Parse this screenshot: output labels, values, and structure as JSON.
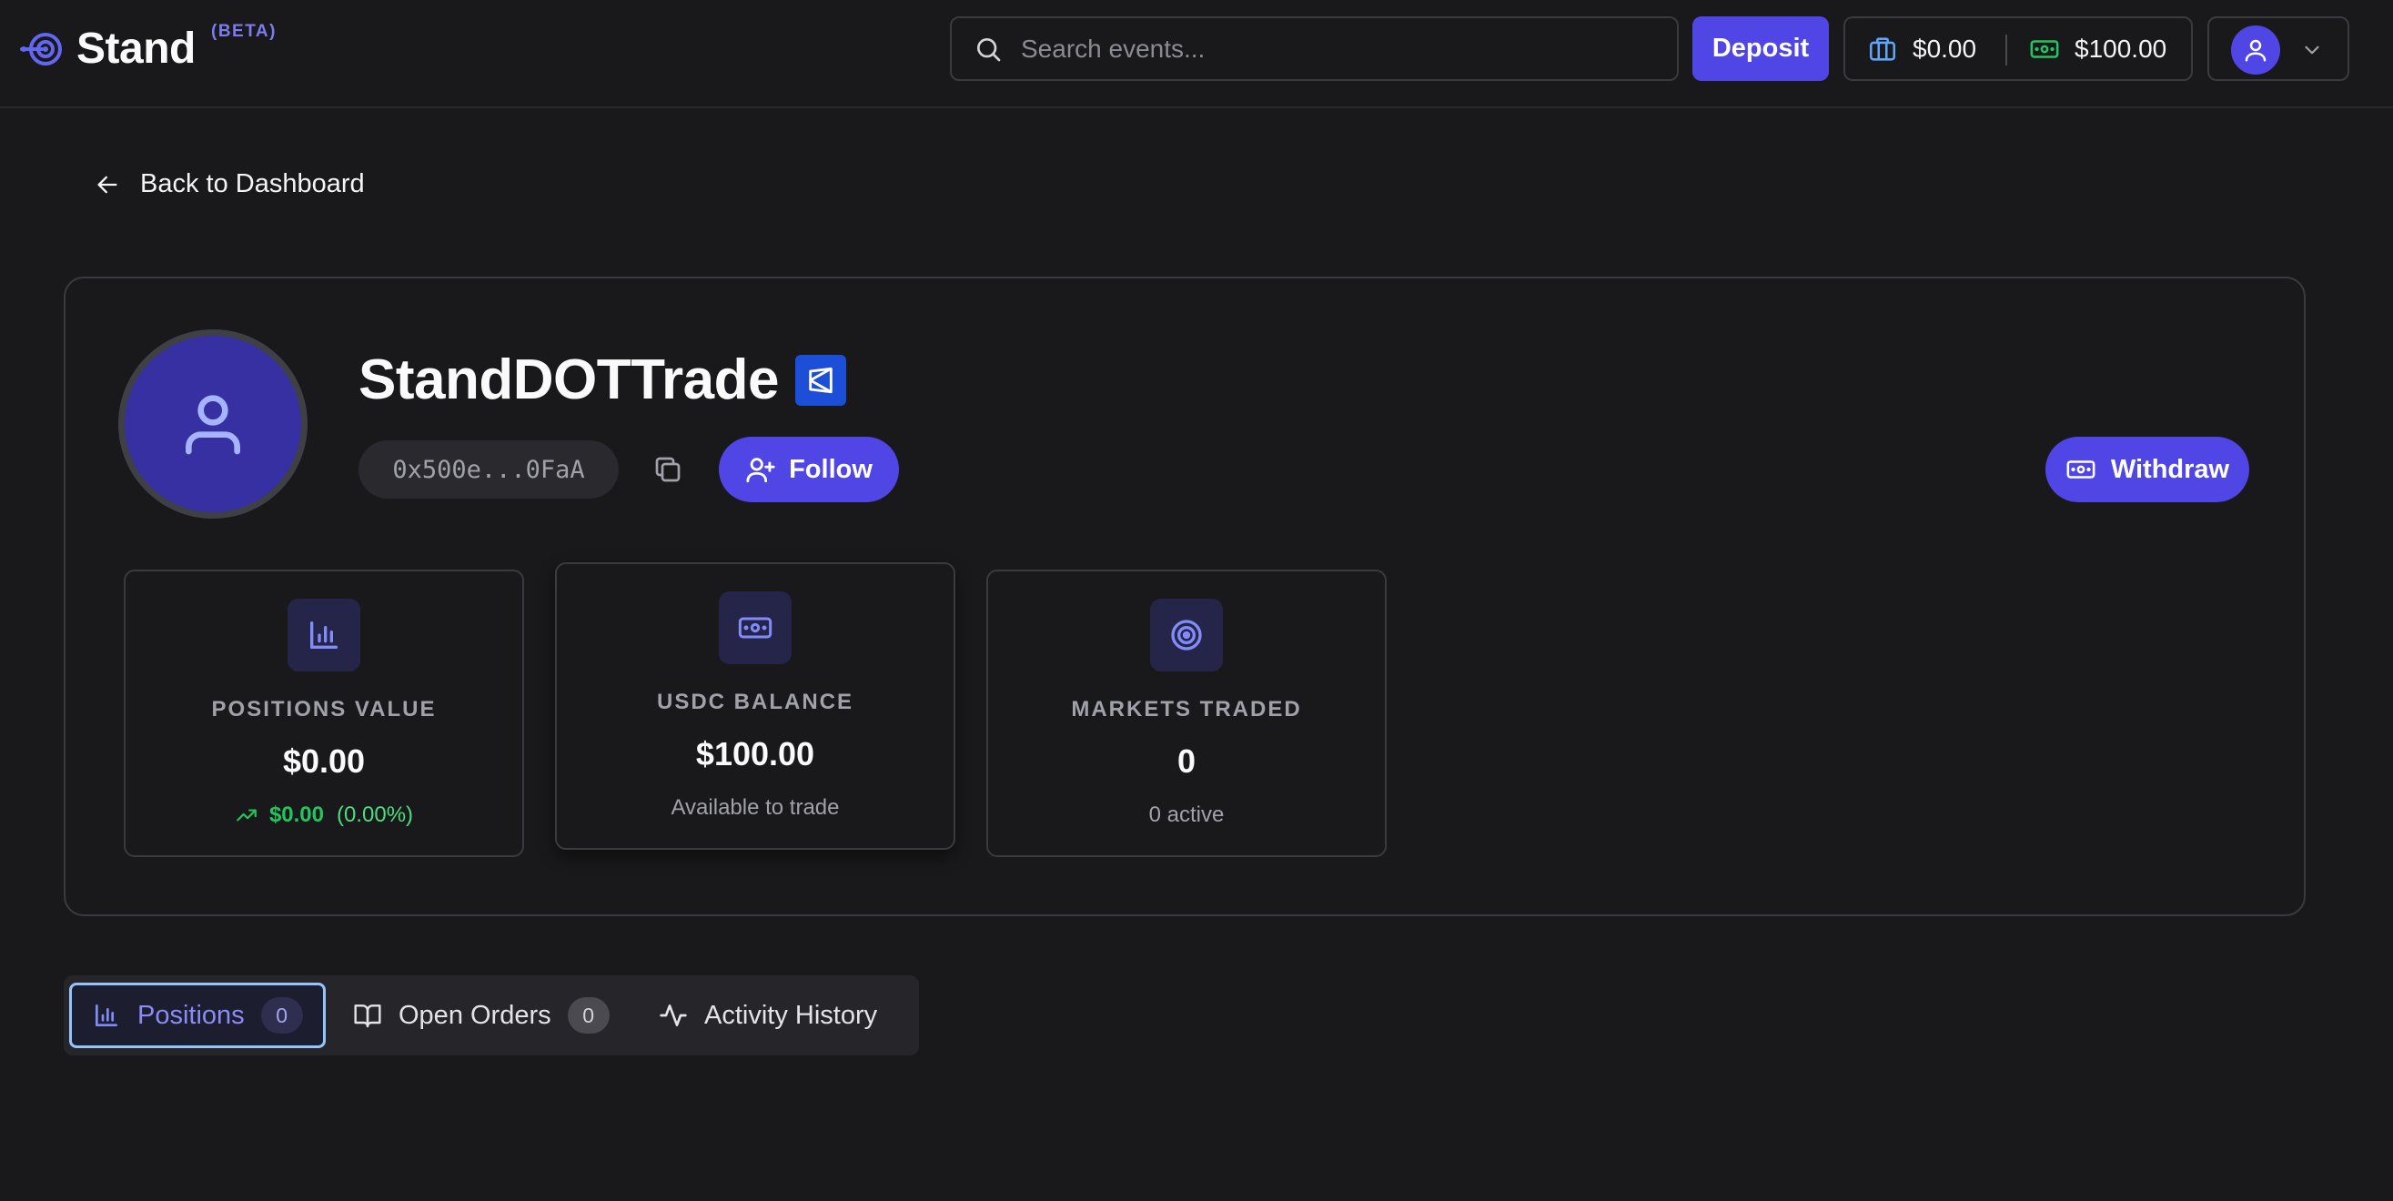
{
  "header": {
    "brand": "Stand",
    "beta": "(BETA)",
    "search_placeholder": "Search events...",
    "deposit_label": "Deposit",
    "portfolio_balance": "$0.00",
    "cash_balance": "$100.00"
  },
  "back_label": "Back to Dashboard",
  "profile": {
    "username": "StandDOTTrade",
    "address": "0x500e...0FaA",
    "follow_label": "Follow",
    "withdraw_label": "Withdraw"
  },
  "stats": [
    {
      "label": "POSITIONS VALUE",
      "value": "$0.00",
      "pnl_value": "$0.00",
      "pnl_percent": "(0.00%)"
    },
    {
      "label": "USDC BALANCE",
      "value": "$100.00",
      "sub": "Available to trade"
    },
    {
      "label": "MARKETS TRADED",
      "value": "0",
      "sub": "0 active"
    }
  ],
  "tabs": [
    {
      "label": "Positions",
      "count": "0"
    },
    {
      "label": "Open Orders",
      "count": "0"
    },
    {
      "label": "Activity History"
    }
  ],
  "colors": {
    "background": "#19191b",
    "accent": "#4f46e5",
    "positive": "#22c55e",
    "verified": "#1d4ed8"
  }
}
